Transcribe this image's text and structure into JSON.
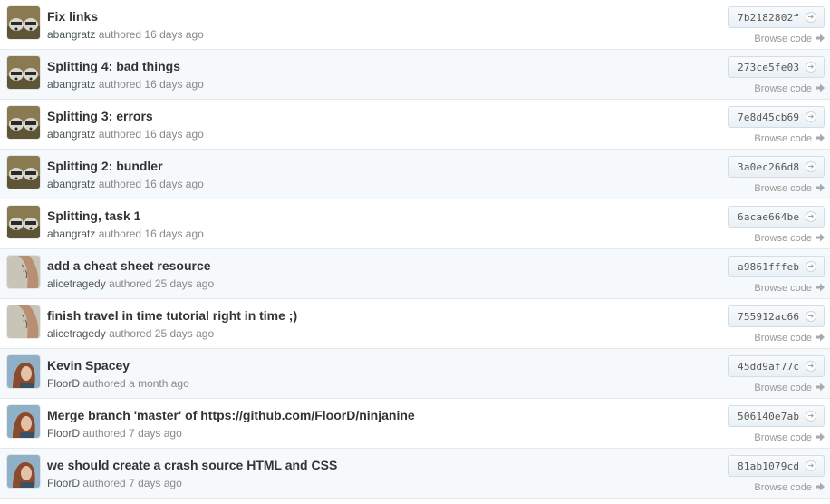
{
  "commits": [
    {
      "message": "Fix links",
      "author": "abangratz",
      "when": "authored 16 days ago",
      "sha": "7b2182802f",
      "browse": "Browse code",
      "avatar": "raccoon-avatar"
    },
    {
      "message": "Splitting 4: bad things",
      "author": "abangratz",
      "when": "authored 16 days ago",
      "sha": "273ce5fe03",
      "browse": "Browse code",
      "avatar": "raccoon-avatar"
    },
    {
      "message": "Splitting 3: errors",
      "author": "abangratz",
      "when": "authored 16 days ago",
      "sha": "7e8d45cb69",
      "browse": "Browse code",
      "avatar": "raccoon-avatar"
    },
    {
      "message": "Splitting 2: bundler",
      "author": "abangratz",
      "when": "authored 16 days ago",
      "sha": "3a0ec266d8",
      "browse": "Browse code",
      "avatar": "raccoon-avatar"
    },
    {
      "message": "Splitting, task 1",
      "author": "abangratz",
      "when": "authored 16 days ago",
      "sha": "6acae664be",
      "browse": "Browse code",
      "avatar": "raccoon-avatar"
    },
    {
      "message": "add a cheat sheet resource",
      "author": "alicetragedy",
      "when": "authored 25 days ago",
      "sha": "a9861fffeb",
      "browse": "Browse code",
      "avatar": "arm-avatar"
    },
    {
      "message": "finish travel in time tutorial right in time ;)",
      "author": "alicetragedy",
      "when": "authored 25 days ago",
      "sha": "755912ac66",
      "browse": "Browse code",
      "avatar": "arm-avatar"
    },
    {
      "message": "Kevin Spacey",
      "author": "FloorD",
      "when": "authored a month ago",
      "sha": "45dd9af77c",
      "browse": "Browse code",
      "avatar": "woman-avatar"
    },
    {
      "message": "Merge branch 'master' of https://github.com/FloorD/ninjanine",
      "author": "FloorD",
      "when": "authored 7 days ago",
      "sha": "506140e7ab",
      "browse": "Browse code",
      "avatar": "woman-avatar"
    },
    {
      "message": "we should create a crash source HTML and CSS",
      "author": "FloorD",
      "when": "authored 7 days ago",
      "sha": "81ab1079cd",
      "browse": "Browse code",
      "avatar": "woman-avatar"
    }
  ],
  "colors": {
    "row_alt": "#f6f9fb",
    "title": "#333333",
    "meta": "#888888",
    "author": "#4e575b"
  }
}
